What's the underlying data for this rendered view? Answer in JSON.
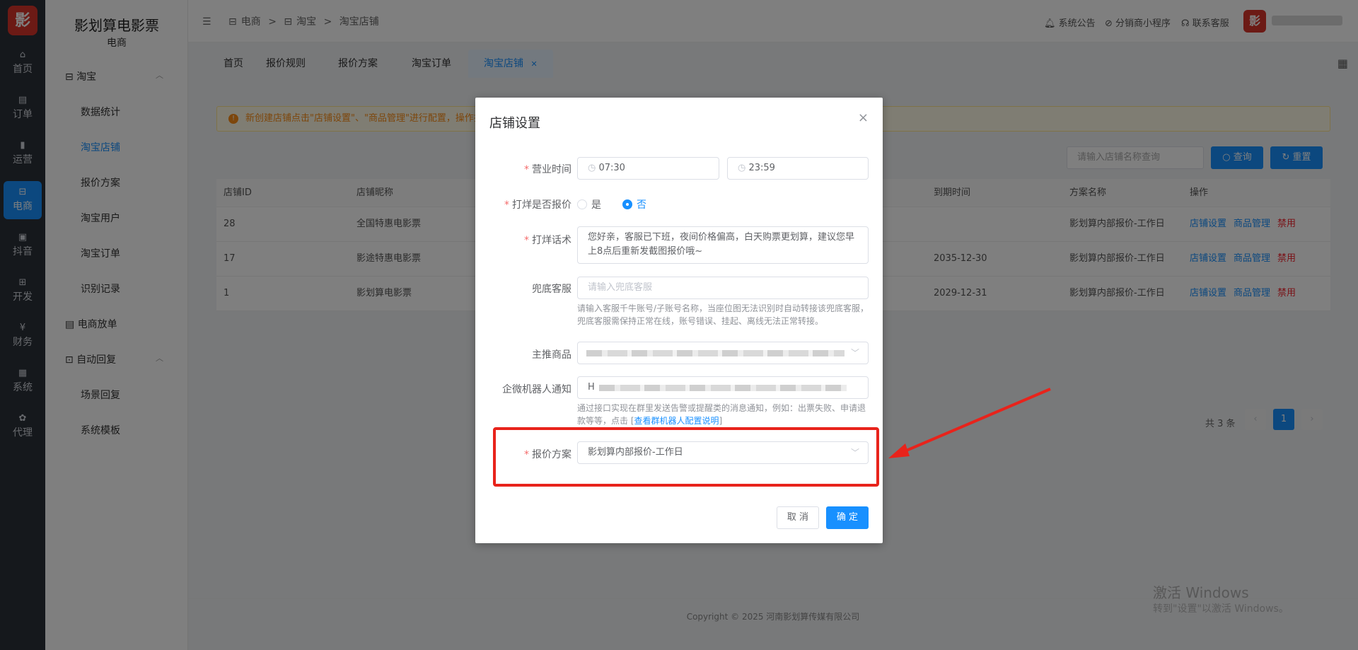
{
  "brand": {
    "logo": "影",
    "title": "影划算电影票",
    "sub": "电商"
  },
  "rail": [
    {
      "icon": "home-icon",
      "glyph": "⌂",
      "label": "首页"
    },
    {
      "icon": "order-icon",
      "glyph": "▤",
      "label": "订单"
    },
    {
      "icon": "chart-icon",
      "glyph": "▮",
      "label": "运营"
    },
    {
      "icon": "store-icon",
      "glyph": "⊟",
      "label": "电商"
    },
    {
      "icon": "video-icon",
      "glyph": "▣",
      "label": "抖音"
    },
    {
      "icon": "dev-icon",
      "glyph": "⊞",
      "label": "开发"
    },
    {
      "icon": "finance-icon",
      "glyph": "¥",
      "label": "财务"
    },
    {
      "icon": "system-icon",
      "glyph": "▦",
      "label": "系统"
    },
    {
      "icon": "agent-icon",
      "glyph": "✿",
      "label": "代理"
    }
  ],
  "menu": {
    "taobao": "淘宝",
    "items": [
      "数据统计",
      "淘宝店铺",
      "报价方案",
      "淘宝用户",
      "淘宝订单",
      "识别记录"
    ],
    "ecom_order": "电商放单",
    "auto_reply": "自动回复",
    "auto_items": [
      "场景回复",
      "系统模板"
    ]
  },
  "breadcrumb": [
    "电商",
    "淘宝",
    "淘宝店铺"
  ],
  "header": {
    "notice": "系统公告",
    "mini": "分销商小程序",
    "service": "联系客服",
    "avatar": "影"
  },
  "tabs": [
    "首页",
    "报价规则",
    "报价方案",
    "淘宝订单",
    "淘宝店铺"
  ],
  "notice": "新创建店铺点击\"店铺设置\"、\"商品管理\"进行配置，操作指",
  "search": {
    "placeholder": "请输入店铺名称查询",
    "query": "查询",
    "reset": "重置"
  },
  "table": {
    "headers": [
      "店铺ID",
      "店铺昵称",
      "到期时间",
      "方案名称",
      "操作"
    ],
    "rows": [
      {
        "id": "28",
        "name": "全国特惠电影票",
        "expire": "",
        "plan": "影划算内部报价-工作日"
      },
      {
        "id": "17",
        "name": "影途特惠电影票",
        "expire": "2035-12-30",
        "plan": "影划算内部报价-工作日"
      },
      {
        "id": "1",
        "name": "影划算电影票",
        "expire": "2029-12-31",
        "plan": "影划算内部报价-工作日"
      }
    ],
    "actions": {
      "settings": "店铺设置",
      "goods": "商品管理",
      "disable": "禁用"
    }
  },
  "pagination": {
    "total": "共 3 条",
    "page": "1",
    "prev": "‹",
    "next": "›"
  },
  "footer": "Copyright © 2025 河南影划算传媒有限公司",
  "watermark": {
    "l1": "激活 Windows",
    "l2": "转到\"设置\"以激活 Windows。"
  },
  "dialog": {
    "title": "店铺设置",
    "close": "×",
    "hours_label": "营业时间",
    "start": "07:30",
    "end": "23:59",
    "quote_label": "打烊是否报价",
    "yes": "是",
    "no": "否",
    "closing_label": "打烊话术",
    "closing_text": "您好亲，客服已下班，夜间价格偏高，白天购票更划算，建议您早上8点后重新发截图报价哦~",
    "fallback_label": "兜底客服",
    "fallback_placeholder": "请输入兜底客服",
    "fallback_help": "请输入客服千牛账号/子账号名称，当座位图无法识别时自动转接该兜底客服，兜底客服需保持正常在线，账号错误、挂起、离线无法正常转接。",
    "main_label": "主推商品",
    "robot_label": "企微机器人通知",
    "robot_prefix": "H",
    "robot_help": "通过接口实现在群里发送告警或提醒类的消息通知，例如：出票失败、申请退款等等，点击 [",
    "robot_link": "查看群机器人配置说明",
    "robot_help_end": "]",
    "plan_label": "报价方案",
    "plan_value": "影划算内部报价-工作日",
    "cancel": "取 消",
    "ok": "确 定"
  },
  "colors": {
    "primary": "#1890ff",
    "highlight": "#e8231b",
    "rail": "#2b3038"
  }
}
